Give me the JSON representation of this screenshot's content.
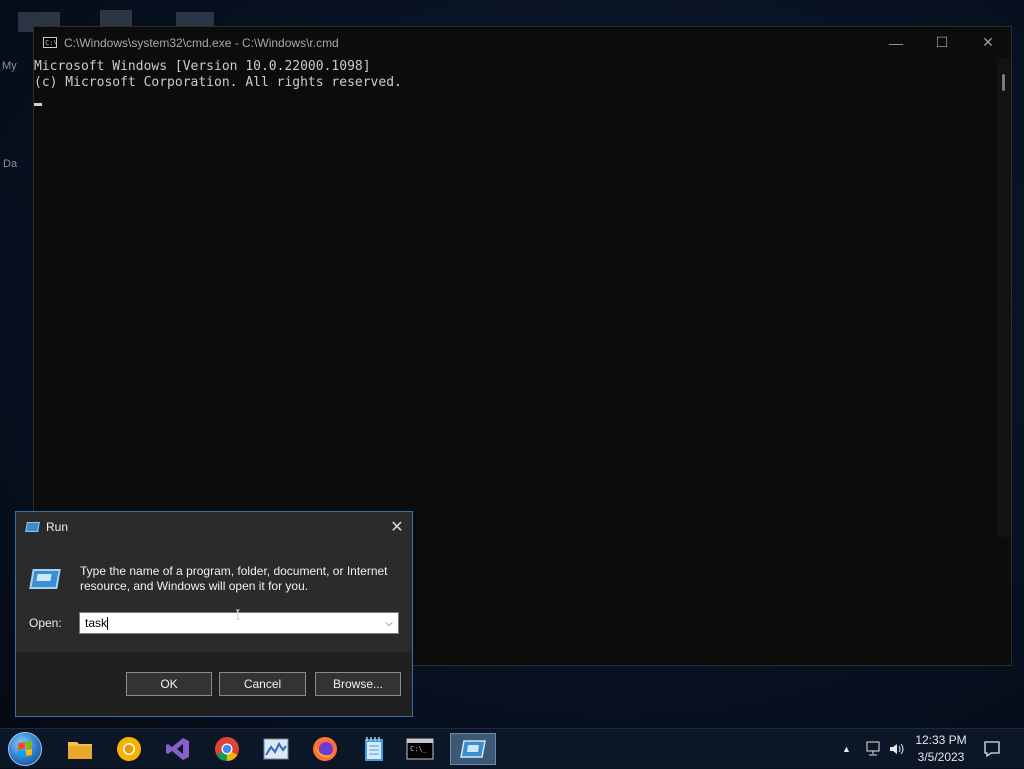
{
  "cmd_window": {
    "title": "C:\\Windows\\system32\\cmd.exe - C:\\Windows\\r.cmd",
    "lines": [
      "Microsoft Windows [Version 10.0.22000.1098]",
      "(c) Microsoft Corporation. All rights reserved."
    ],
    "controls": {
      "minimize": "—",
      "maximize": "☐",
      "close": "✕"
    }
  },
  "desktop": {
    "label_fragment_1": "My",
    "label_fragment_2": "Da"
  },
  "run_dialog": {
    "title": "Run",
    "close": "✕",
    "description": "Type the name of a program, folder, document, or Internet resource, and Windows will open it for you.",
    "open_label": "Open:",
    "open_value": "task",
    "buttons": {
      "ok": "OK",
      "cancel": "Cancel",
      "browse": "Browse..."
    }
  },
  "taskbar": {
    "apps": [
      "start-icon",
      "file-explorer-icon",
      "chrome-canary-icon",
      "visual-studio-icon",
      "chrome-icon",
      "resource-monitor-icon",
      "firefox-icon",
      "notepad-icon",
      "cmd-icon",
      "run-icon"
    ],
    "clock": {
      "time": "12:33 PM",
      "date": "3/5/2023"
    }
  },
  "colors": {
    "accent": "#3a6ea5",
    "console_bg": "#0c0c0c",
    "console_fg": "#cccccc"
  }
}
